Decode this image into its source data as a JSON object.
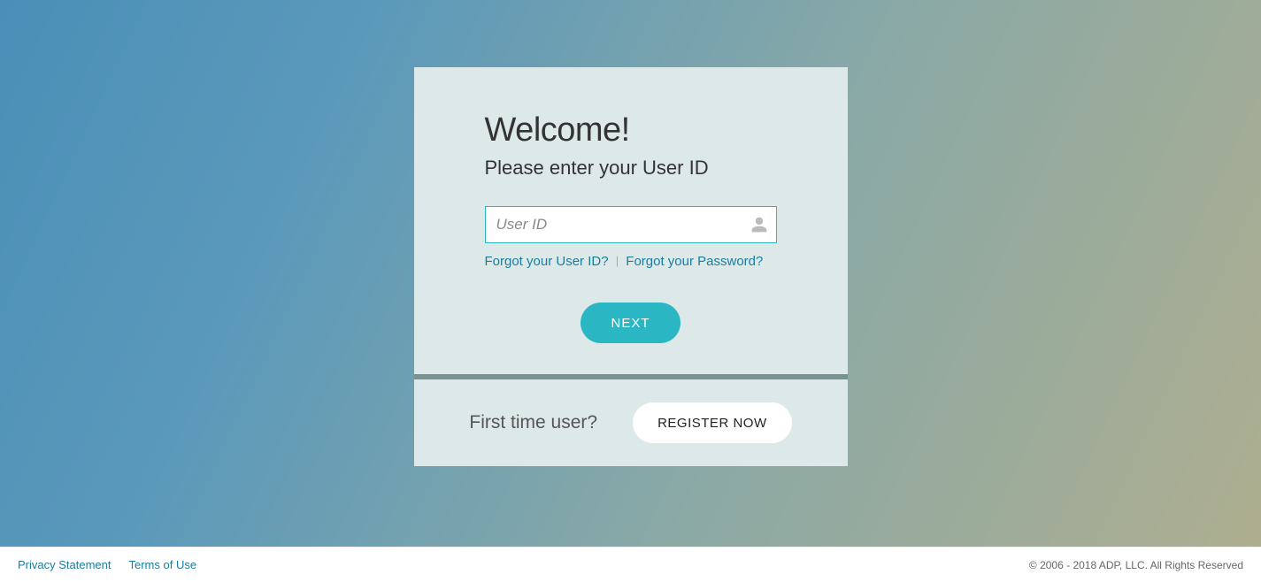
{
  "login": {
    "title": "Welcome!",
    "subtitle": "Please enter your User ID",
    "user_id_placeholder": "User ID",
    "user_id_value": "",
    "forgot_user_id": "Forgot your User ID?",
    "forgot_password": "Forgot your Password?",
    "next_label": "NEXT"
  },
  "register": {
    "prompt": "First time user?",
    "button_label": "REGISTER NOW"
  },
  "footer": {
    "privacy": "Privacy Statement",
    "terms": "Terms of Use",
    "copyright": "© 2006 - 2018 ADP, LLC. All Rights Reserved"
  },
  "colors": {
    "accent": "#2bb6c4",
    "link": "#1a7da0",
    "card_bg": "#dde9e8"
  }
}
